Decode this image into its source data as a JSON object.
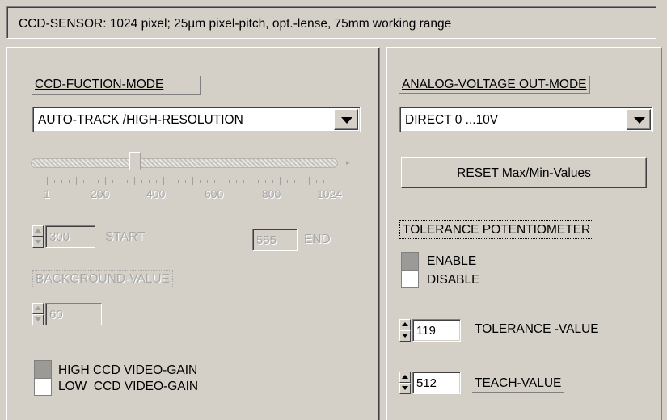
{
  "header": {
    "text": "CCD-SENSOR: 1024 pixel; 25µm pixel-pitch, opt.-lense, 75mm working range"
  },
  "left": {
    "function_mode": {
      "label": "CCD-FUCTION-MODE",
      "selected": "AUTO-TRACK /HIGH-RESOLUTION"
    },
    "slider": {
      "min": 1,
      "max": 1024,
      "value": 300,
      "tick_labels": [
        "1",
        "200",
        "400",
        "600",
        "800",
        "1024"
      ],
      "enabled": false
    },
    "start": {
      "value": "300",
      "label": "START"
    },
    "end": {
      "value": "555",
      "label": "END"
    },
    "background": {
      "label": "BACKGROUND-VALUE",
      "value": "60"
    },
    "video_gain": {
      "high_label": "HIGH CCD VIDEO-GAIN",
      "low_label": "LOW  CCD VIDEO-GAIN",
      "selected": "high"
    }
  },
  "right": {
    "analog_mode": {
      "label": "ANALOG-VOLTAGE OUT-MODE",
      "selected": "DIRECT 0 ...10V"
    },
    "reset_button": {
      "label_underlined": "R",
      "label_rest": "ESET Max/Min-Values"
    },
    "tolerance_pot": {
      "label": "TOLERANCE POTENTIOMETER",
      "enable_label": "ENABLE",
      "disable_label": "DISABLE",
      "selected": "enable"
    },
    "tolerance_value": {
      "value": "119",
      "label": "TOLERANCE -VALUE"
    },
    "teach_value": {
      "value": "512",
      "label": "TEACH-VALUE"
    }
  },
  "colors": {
    "face": "#d4d0c8",
    "shadow": "#808080",
    "highlight": "#ffffff",
    "disabled_text": "#a8a8a8",
    "toggle_on": "#9c9a96"
  }
}
